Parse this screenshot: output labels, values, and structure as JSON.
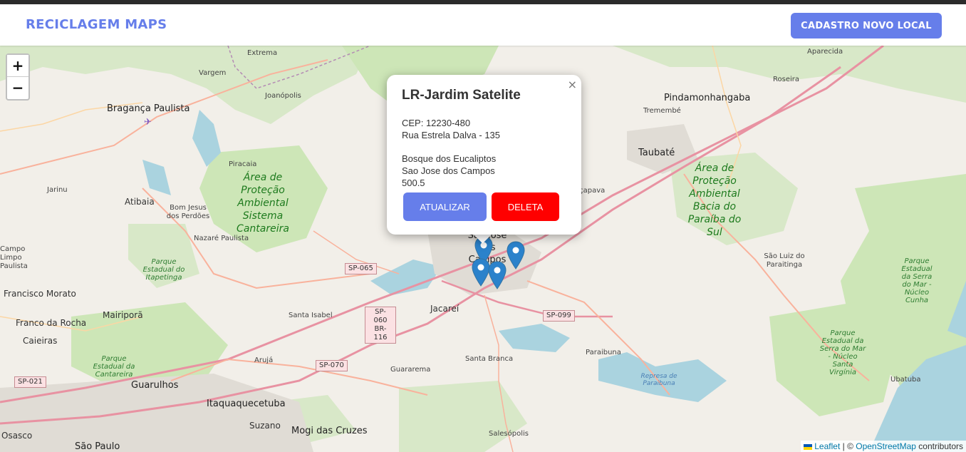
{
  "navbar": {
    "brand": "RECICLAGEM MAPS",
    "cadastro_button": "CADASTRO NOVO LOCAL"
  },
  "map": {
    "zoom_in": "+",
    "zoom_out": "−",
    "cities": [
      "Extrema",
      "Aparecida",
      "Vargem",
      "Joanópolis",
      "Roseira",
      "Bragança Paulista",
      "Pindamonhangaba",
      "Tremembé",
      "Taubaté",
      "Piracaia",
      "Jarinu",
      "Atibaia",
      "Bom Jesus dos Perdões",
      "Nazaré Paulista",
      "Campo Limpo Paulista",
      "Francisco Morato",
      "Mairiporã",
      "Franco da Rocha",
      "Caieiras",
      "Santa Isabel",
      "Jacareí",
      "Santa Branca",
      "Paraibuna",
      "São Luiz do Paraitinga",
      "Arujá",
      "Guararema",
      "Guarulhos",
      "Itaquaquecetuba",
      "Suzano",
      "Mogi das Cruzes",
      "Salesópolis",
      "Osasco",
      "São Paulo",
      "Ubatuba",
      "São José dos Campos",
      "Caçapava"
    ],
    "protected_areas": [
      "Área de Proteção Ambiental Sistema Cantareira",
      "Área de Proteção Ambiental Bacia do Paraíba do Sul"
    ],
    "parks": [
      "Parque Estadual do Itapetinga",
      "Parque Estadual da Cantareira",
      "Parque Estadual da Serra do Mar - Núcleo Cunha",
      "Parque Estadual da Serra do Mar - Núcleo Santa Virgínia"
    ],
    "water": [
      "Represa de Paraibuna"
    ],
    "roads": [
      "SP-065",
      "SP-060",
      "BR-116",
      "SP-099",
      "SP-070",
      "SP-021"
    ],
    "markers": [
      {
        "name": "marker-1"
      },
      {
        "name": "marker-2"
      },
      {
        "name": "marker-3"
      },
      {
        "name": "marker-4"
      }
    ]
  },
  "popup": {
    "title": "LR-Jardim Satelite",
    "close": "×",
    "cep": "CEP: 12230-480",
    "street": "Rua Estrela Dalva - 135",
    "neighborhood": "Bosque dos Eucaliptos",
    "city": "Sao Jose dos Campos",
    "value": "500.5",
    "update_button": "ATUALIZAR",
    "delete_button": "DELETA"
  },
  "attribution": {
    "leaflet": "Leaflet",
    "separator": " | © ",
    "osm": "OpenStreetMap",
    "contributors": " contributors"
  },
  "colors": {
    "accent": "#667eea",
    "delete": "#ff0000",
    "marker": "#2b82cb",
    "forest": "#cde6b7",
    "water": "#aad3df",
    "motorway": "#e892a2"
  }
}
